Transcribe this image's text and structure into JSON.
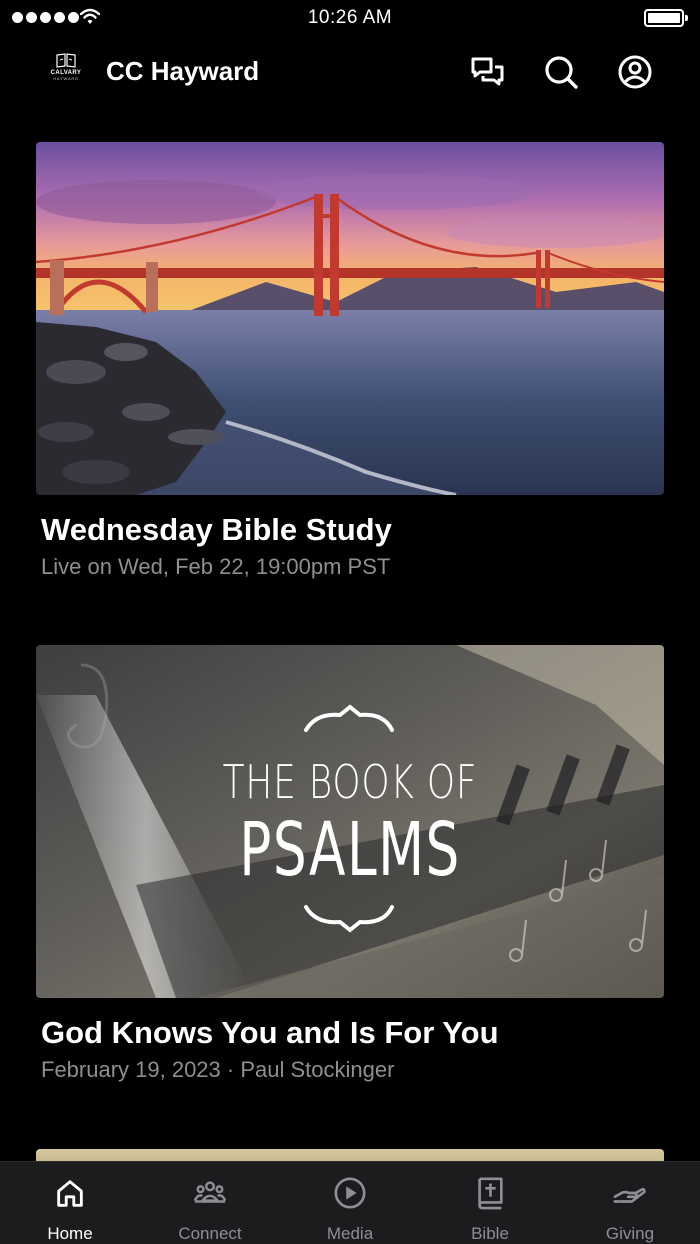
{
  "status_bar": {
    "time": "10:26 AM"
  },
  "header": {
    "logo_line1": "CALVARY",
    "logo_line2": "HAYWARD",
    "title": "CC Hayward",
    "icons": [
      "chat-icon",
      "search-icon",
      "profile-icon"
    ]
  },
  "cards": [
    {
      "title": "Wednesday Bible Study",
      "subtitle": "Live on Wed, Feb 22, 19:00pm PST",
      "image": "golden-gate-bridge-sunset"
    },
    {
      "title": "God Knows You and Is For You",
      "subtitle": "February 19, 2023 · Paul Stockinger",
      "image": "book-of-psalms",
      "image_text_line1": "THE BOOK OF",
      "image_text_line2": "PSALMS"
    }
  ],
  "tabs": [
    {
      "label": "Home",
      "icon": "home-icon",
      "active": true
    },
    {
      "label": "Connect",
      "icon": "people-icon",
      "active": false
    },
    {
      "label": "Media",
      "icon": "play-icon",
      "active": false
    },
    {
      "label": "Bible",
      "icon": "bible-icon",
      "active": false
    },
    {
      "label": "Giving",
      "icon": "giving-hand-icon",
      "active": false
    }
  ]
}
